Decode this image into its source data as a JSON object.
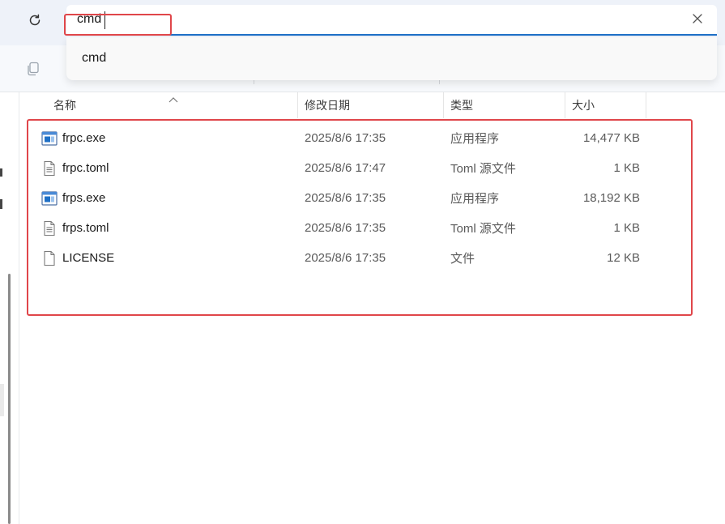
{
  "address_bar": {
    "value": "cmd",
    "clear_icon": "close-icon",
    "refresh_icon": "refresh-icon"
  },
  "suggestions": [
    "cmd"
  ],
  "toolbar": {
    "copy_icon": "copy-icon"
  },
  "columns": {
    "name": "名称",
    "modified": "修改日期",
    "type": "类型",
    "size": "大小"
  },
  "files": [
    {
      "name": "frpc.exe",
      "modified": "2025/8/6 17:35",
      "type": "应用程序",
      "size": "14,477 KB",
      "icon": "exe-icon"
    },
    {
      "name": "frpc.toml",
      "modified": "2025/8/6 17:47",
      "type": "Toml 源文件",
      "size": "1 KB",
      "icon": "text-file-icon"
    },
    {
      "name": "frps.exe",
      "modified": "2025/8/6 17:35",
      "type": "应用程序",
      "size": "18,192 KB",
      "icon": "exe-icon"
    },
    {
      "name": "frps.toml",
      "modified": "2025/8/6 17:35",
      "type": "Toml 源文件",
      "size": "1 KB",
      "icon": "text-file-icon"
    },
    {
      "name": "LICENSE",
      "modified": "2025/8/6 17:35",
      "type": "文件",
      "size": "12 KB",
      "icon": "blank-file-icon"
    }
  ],
  "colors": {
    "accent": "#1e6fc6",
    "annotation": "#e0464a"
  }
}
